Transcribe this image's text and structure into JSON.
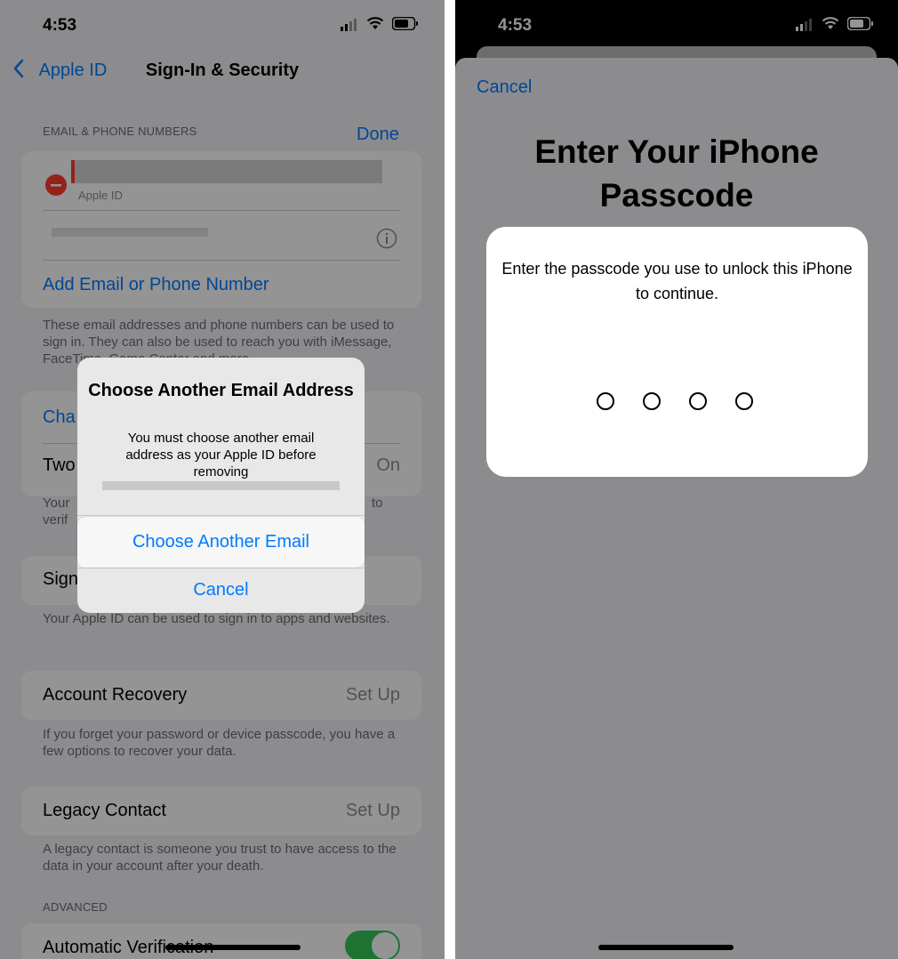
{
  "left": {
    "status": {
      "time": "4:53"
    },
    "nav": {
      "back_label": "Apple ID",
      "title": "Sign-In & Security"
    },
    "email_section": {
      "header": "EMAIL & PHONE NUMBERS",
      "done_label": "Done",
      "item_sublabel": "Apple ID",
      "add_label": "Add Email or Phone Number",
      "footnote": "These email addresses and phone numbers can be used to sign in. They can also be used to reach you with iMessage, FaceTime, Game Center and more."
    },
    "change_password_label": "Cha",
    "two_factor": {
      "label": "Two",
      "value": "On",
      "footnote_start": "Your",
      "footnote_end": "to",
      "footnote_line2": "verif"
    },
    "sign_in_apple": {
      "label": "Sign",
      "footnote": "Your Apple ID can be used to sign in to apps and websites."
    },
    "account_recovery": {
      "label": "Account Recovery",
      "value": "Set Up",
      "footnote": "If you forget your password or device passcode, you have a few options to recover your data."
    },
    "legacy_contact": {
      "label": "Legacy Contact",
      "value": "Set Up",
      "footnote": "A legacy contact is someone you trust to have access to the data in your account after your death."
    },
    "advanced": {
      "header": "ADVANCED",
      "auto_verify_label": "Automatic Verification"
    },
    "alert": {
      "title": "Choose Another Email Address",
      "message": "You must choose another email address as your Apple ID before removing",
      "choose_label": "Choose Another Email",
      "cancel_label": "Cancel"
    }
  },
  "right": {
    "status": {
      "time": "4:53"
    },
    "cancel_label": "Cancel",
    "title": "Enter Your iPhone Passcode",
    "prompt": "Enter the passcode you use to unlock this iPhone to continue.",
    "passcode_dots": 4
  },
  "colors": {
    "accent": "#007aff",
    "toggle_on": "#34c759",
    "destructive": "#ff3b30"
  }
}
